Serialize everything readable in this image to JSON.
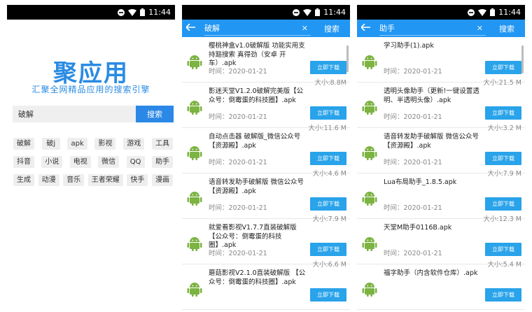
{
  "status": {
    "time": "11:44"
  },
  "home": {
    "logo": "聚应用",
    "slogan": "汇聚全网精品应用的搜索引擎",
    "search_value": "破解",
    "search_button": "搜索",
    "tag_rows": [
      [
        "破解",
        "破j",
        "apk",
        "影视",
        "游戏",
        "工具"
      ],
      [
        "抖音",
        "小说",
        "电视",
        "微信",
        "QQ",
        "助手"
      ],
      [
        "生成",
        "动漫",
        "音乐",
        "王者荣耀",
        "快手",
        "漫画"
      ]
    ]
  },
  "screen2": {
    "query": "破解",
    "clear": "✕",
    "search_button": "搜索",
    "download_label": "立即下载",
    "items": [
      {
        "title": "樱桃神盒v1.0破解版 功能实用支持豁搜索 真得劲（安卓 开车）.apk",
        "date": "时间：2020-01-21",
        "size": "大小:8.8M"
      },
      {
        "title": "影迷天堂V1.2.0破解完美版【公众号：倒霉蛋的科技圈】.apk",
        "date": "时间：2020-01-21",
        "size": "大小:11.6 M"
      },
      {
        "title": "自动点击器 破解版_微信公众号【资源殿】.apk",
        "date": "时间：2020-01-21",
        "size": "大小:4.6 M"
      },
      {
        "title": "语音转发助手破解版 微信公众号【资源殿】.apk",
        "date": "时间：2020-01-21",
        "size": "大小:7.9 M"
      },
      {
        "title": "就爱看影视V1.7.7直装破解版【公众号：倒霉蛋的科技圈】.apk",
        "date": "时间：2020-01-21",
        "size": "大小:6.6 M"
      },
      {
        "title": "蘑菇影视V2.1.0直装破解版 【公众号：倒霉蛋的科技圈】.apk",
        "date": "",
        "size": ""
      }
    ]
  },
  "screen3": {
    "query": "助手",
    "clear": "✕",
    "search_button": "搜索",
    "download_label": "立即下载",
    "items": [
      {
        "title": "学习助手(1).apk",
        "date": "时间：2020-01-21",
        "size": "大小:21.5 M"
      },
      {
        "title": "透明头像助手（更新!一键设置透明、半透明头像）.apk",
        "date": "时间：2020-01-21",
        "size": "大小:3.2 M"
      },
      {
        "title": "语音转发助手破解版 微信公众号【资源殿】.apk",
        "date": "时间：2020-01-21",
        "size": "大小:7.9 M"
      },
      {
        "title": "Lua布局助手_1.8.5.apk",
        "date": "时间：2020-01-21",
        "size": "大小:12.3 M"
      },
      {
        "title": "天堂M助手0116B.apk",
        "date": "时间：2020-01-21",
        "size": "大小:5.4 M"
      },
      {
        "title": "福字助手（内含软件仓库）.apk",
        "date": "",
        "size": ""
      }
    ]
  }
}
